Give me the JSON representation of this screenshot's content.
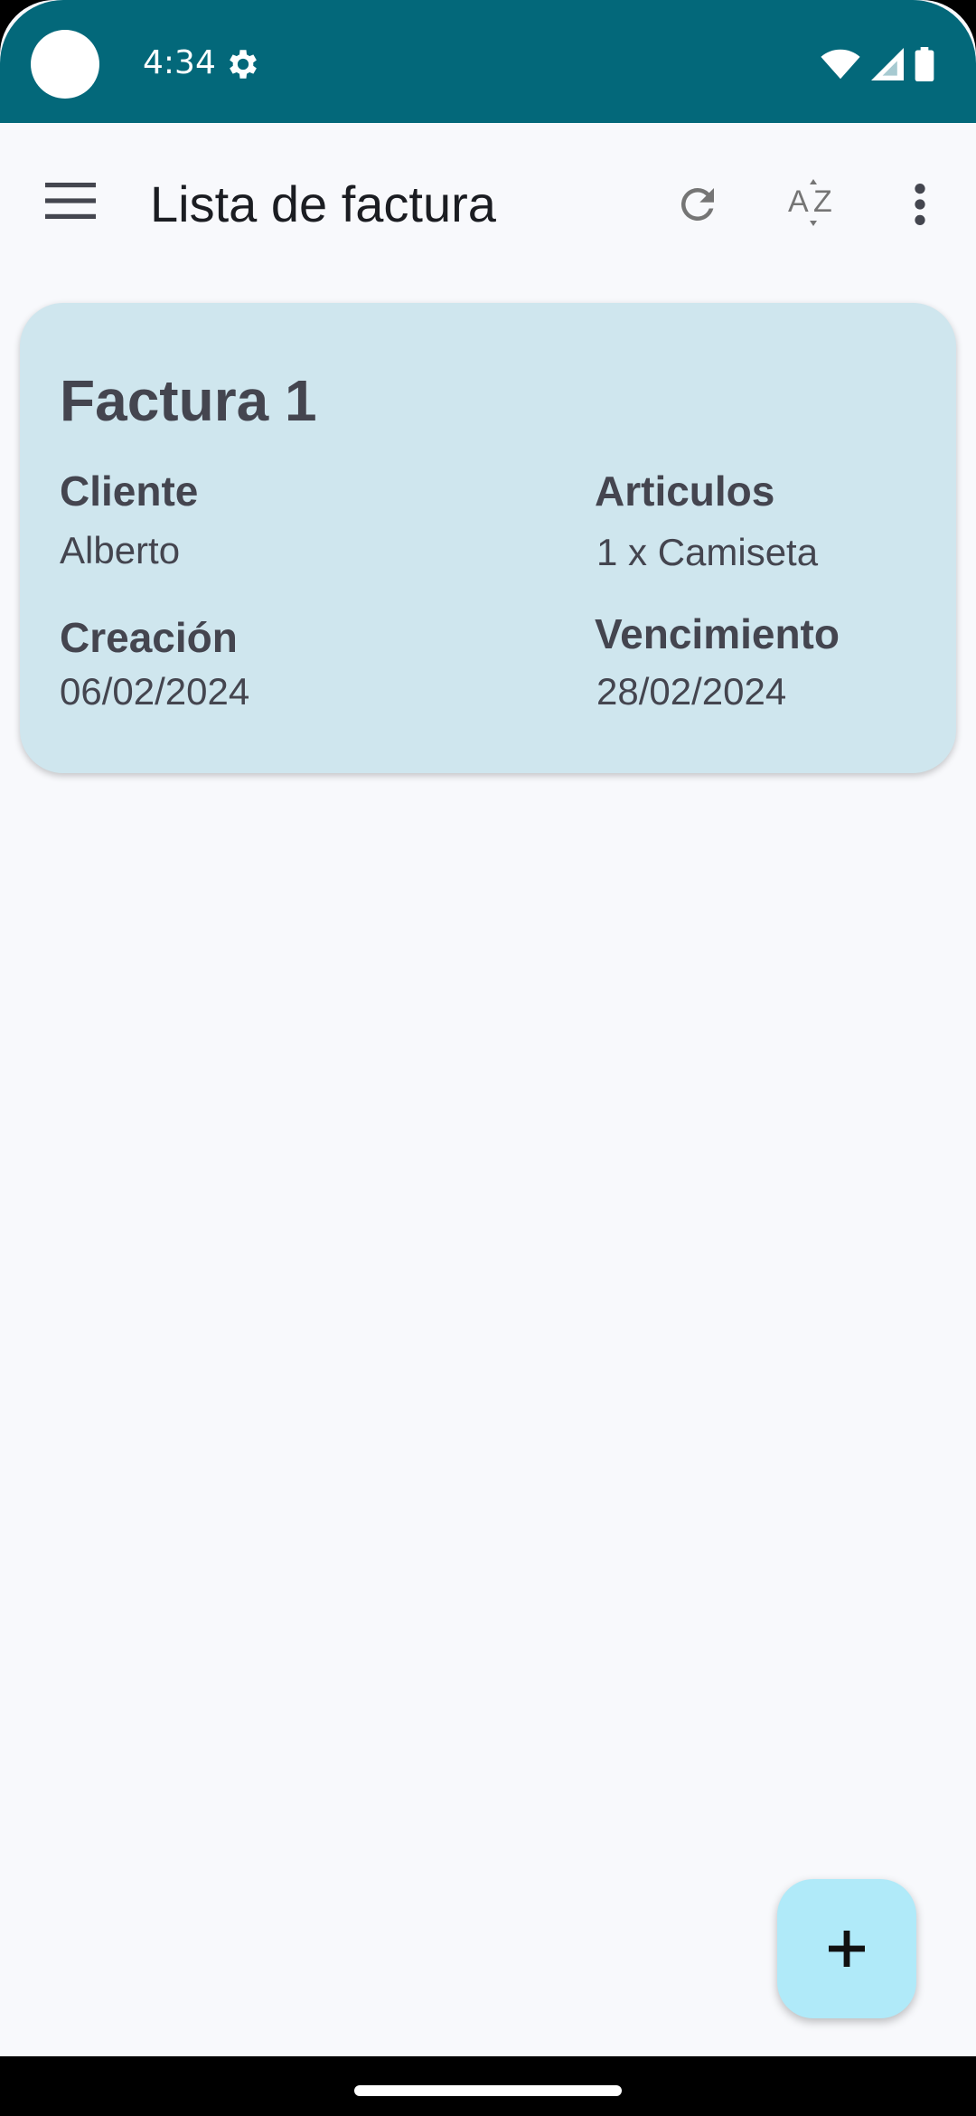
{
  "status_bar": {
    "time": "4:34",
    "icons": [
      "settings-icon",
      "wifi-icon",
      "signal-icon",
      "battery-icon"
    ]
  },
  "app_bar": {
    "title": "Lista de factura",
    "actions": [
      "menu-icon",
      "refresh-icon",
      "sort-az-icon",
      "more-vert-icon"
    ]
  },
  "invoices": [
    {
      "title": "Factura 1",
      "client_label": "Cliente",
      "client": "Alberto",
      "articles_label": "Articulos",
      "articles": "1 x Camiseta",
      "created_label": "Creación",
      "created": "06/02/2024",
      "due_label": "Vencimiento",
      "due": "28/02/2024"
    }
  ],
  "fab": {
    "label": "+",
    "icon": "add-icon"
  },
  "colors": {
    "status_bar": "#03687a",
    "background": "#f8f9fc",
    "card": "#cfe6ee",
    "fab": "#b0eaf9",
    "card_text": "#44454f"
  }
}
